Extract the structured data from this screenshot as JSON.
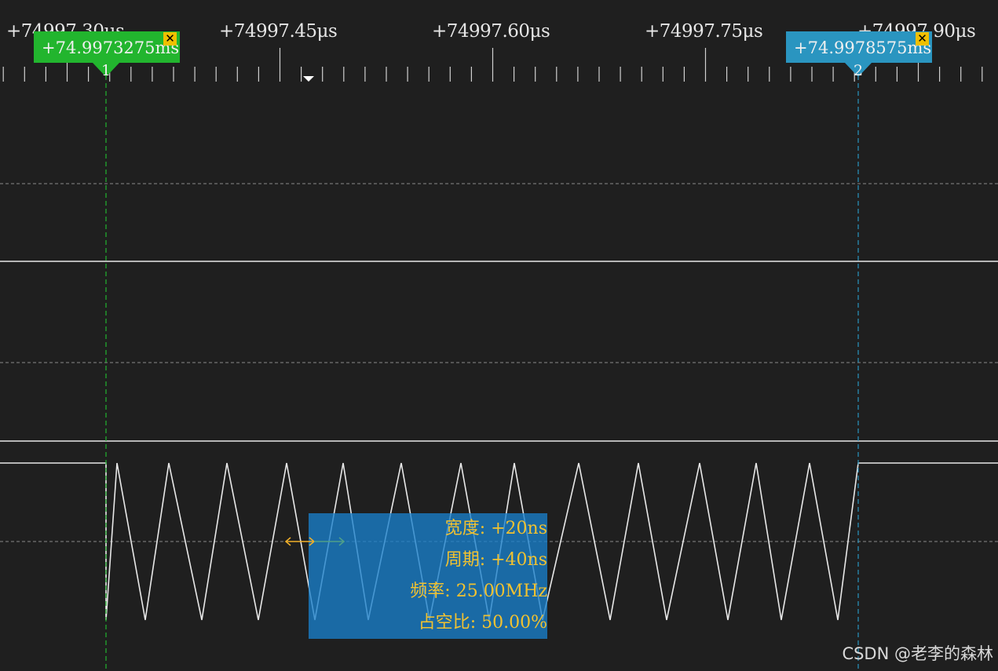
{
  "time_axis": {
    "labels": [
      "+74997.30μs",
      "+74997.45μs",
      "+74997.60μs",
      "+74997.75μs",
      "+74997.90μs"
    ]
  },
  "cursors": [
    {
      "number": "1",
      "time": "+74.9973275ms",
      "color": "#22b52e",
      "close": "✕"
    },
    {
      "number": "2",
      "time": "+74.9978575ms",
      "color": "#2a95c0",
      "close": "✕"
    }
  ],
  "measurement": {
    "width": "宽度: +20ns",
    "period": "周期: +40ns",
    "frequency": "频率: 25.00MHz",
    "duty_cycle": "占空比: 50.00%"
  },
  "watermark": "CSDN @老李的森林",
  "colors": {
    "background": "#1f1f1f",
    "waveform": "#e8e8e8",
    "gridline": "#8a8a8a",
    "measure_arrow": "#f2b02a",
    "measure_text": "#f2c230"
  }
}
